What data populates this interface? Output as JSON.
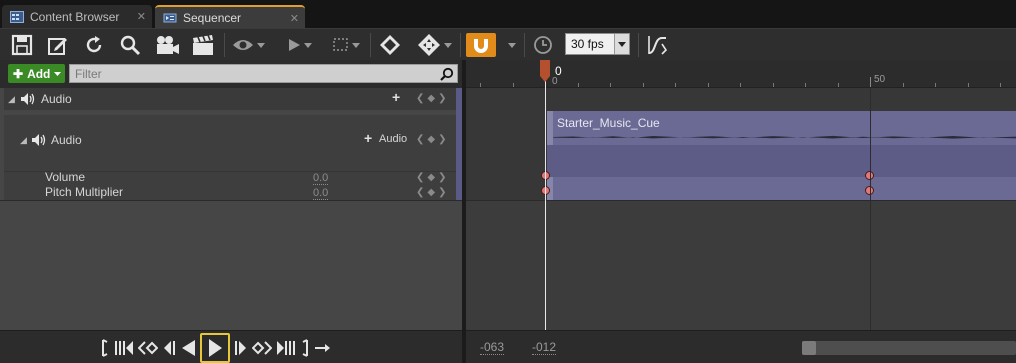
{
  "tabs": [
    {
      "label": "Content Browser",
      "icon": "content-browser-icon",
      "active": false
    },
    {
      "label": "Sequencer",
      "icon": "sequencer-icon",
      "active": true
    }
  ],
  "toolbar": {
    "icons": [
      "save-icon",
      "save-as-icon",
      "refresh-icon",
      "find-icon",
      "camera-icon",
      "clapboard-icon",
      "eye-icon",
      "play-icon",
      "selection-icon",
      "key-icon",
      "transform-icon",
      "snap-magnet-icon",
      "clock-icon",
      "curve-editor-icon"
    ],
    "fps_value": "30 fps",
    "accent_color": "#e08b1a"
  },
  "outliner": {
    "add_label": "Add",
    "filter_placeholder": "Filter",
    "tracks": [
      {
        "label": "Audio",
        "level": 0
      },
      {
        "label": "Audio",
        "level": 1,
        "add_label": "Audio"
      }
    ],
    "properties": [
      {
        "label": "Volume",
        "value": "0.0"
      },
      {
        "label": "Pitch Multiplier",
        "value": "0.0"
      }
    ]
  },
  "timeline": {
    "playhead_frame": "0",
    "ruler_labels": [
      "0",
      "50"
    ],
    "section_title": "Starter_Music_Cue",
    "section_color": "#6a6a95"
  },
  "transport": {
    "icons": [
      "set-start-icon",
      "jump-to-start-icon",
      "prev-key-icon",
      "step-back-icon",
      "play-reverse-icon",
      "play-icon",
      "step-forward-icon",
      "next-key-icon",
      "jump-to-end-icon",
      "set-end-icon",
      "loop-icon"
    ],
    "highlight_color": "#e8c63a"
  },
  "view_range": {
    "start": "-063",
    "end": "-012"
  }
}
